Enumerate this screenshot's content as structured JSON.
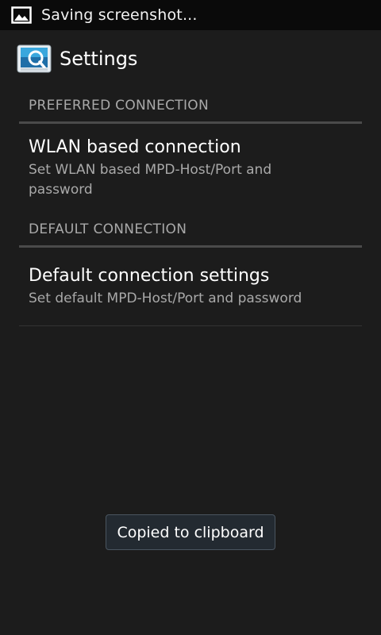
{
  "status_bar": {
    "notification_text": "Saving screenshot...",
    "icon": "image-icon"
  },
  "action_bar": {
    "title": "Settings",
    "icon": "app-settings-icon"
  },
  "sections": [
    {
      "category": "PREFERRED CONNECTION",
      "item": {
        "title": "WLAN based connection",
        "summary": "Set WLAN based MPD-Host/Port and password"
      }
    },
    {
      "category": "DEFAULT CONNECTION",
      "item": {
        "title": "Default connection settings",
        "summary": "Set default MPD-Host/Port and password"
      }
    }
  ],
  "toast": {
    "text": "Copied to clipboard"
  },
  "colors": {
    "background": "#1c1c1c",
    "status_bar": "#0a0a0a",
    "category_text": "#a9a9a9",
    "category_divider": "#4a4a4a",
    "accent_icon": "#3aa7dd"
  }
}
